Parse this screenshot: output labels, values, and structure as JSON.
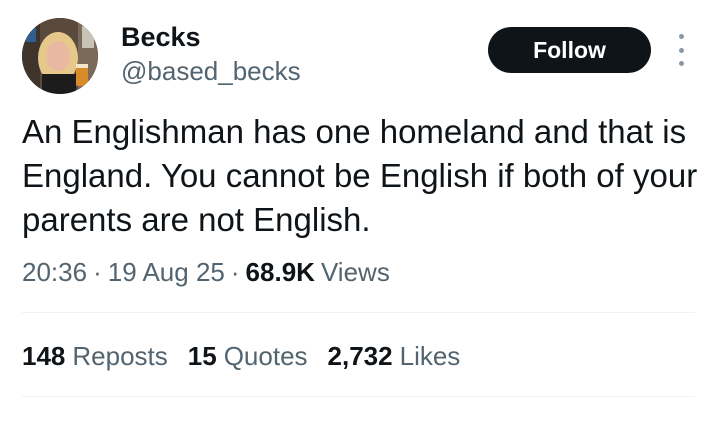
{
  "author": {
    "display_name": "Becks",
    "handle": "@based_becks",
    "avatar_icon": "profile-photo"
  },
  "follow_button": {
    "label": "Follow"
  },
  "more_menu_icon": "vertical-ellipsis-icon",
  "tweet": {
    "text": "An Englishman has one homeland and that is England. You cannot be English if both of your parents are not English."
  },
  "meta": {
    "time": "20:36",
    "separator": "·",
    "date": "19 Aug 25",
    "views_count": "68.9K",
    "views_label": "Views"
  },
  "stats": {
    "reposts": {
      "count": "148",
      "label": "Reposts"
    },
    "quotes": {
      "count": "15",
      "label": "Quotes"
    },
    "likes": {
      "count": "2,732",
      "label": "Likes"
    }
  },
  "colors": {
    "text_primary": "#0f1419",
    "text_secondary": "#536471",
    "follow_bg": "#0f1419",
    "follow_text": "#ffffff",
    "divider": "#eff3f4"
  }
}
